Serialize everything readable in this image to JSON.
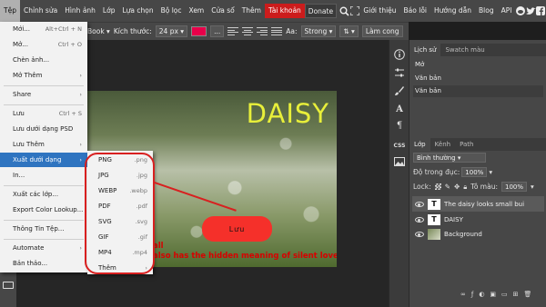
{
  "menubar": {
    "items": [
      "Tệp",
      "Chỉnh sửa",
      "Hình ảnh",
      "Lớp",
      "Lựa chọn",
      "Bộ lọc",
      "Xem",
      "Cửa sổ",
      "Thêm"
    ],
    "account": "Tài khoản",
    "donate": "Donate",
    "right_items": [
      "Giới thiệu",
      "Báo lỗi",
      "Hướng dẫn",
      "Blog",
      "API"
    ]
  },
  "optbar": {
    "font": "Book",
    "size_label": "Kích thước:",
    "size_value": "24 px",
    "color": "#e8004a",
    "more": "...",
    "aa_label": "Aa:",
    "aa_value": "Strong",
    "commit": "Làm cong"
  },
  "filemenu": {
    "items": [
      {
        "label": "Mới...",
        "shortcut": "Alt+Ctrl + N"
      },
      {
        "label": "Mở...",
        "shortcut": "Ctrl + O"
      },
      {
        "label": "Chèn ảnh...",
        "shortcut": ""
      },
      {
        "label": "Mở Thêm",
        "shortcut": "›"
      },
      {
        "label": "Share",
        "shortcut": "›"
      },
      {
        "label": "Lưu",
        "shortcut": "Ctrl + S"
      },
      {
        "label": "Lưu dưới dạng PSD",
        "shortcut": ""
      },
      {
        "label": "Lưu Thêm",
        "shortcut": "›"
      },
      {
        "label": "Xuất dưới dạng",
        "shortcut": "›"
      },
      {
        "label": "In...",
        "shortcut": ""
      },
      {
        "label": "Xuất các lớp...",
        "shortcut": ""
      },
      {
        "label": "Export Color Lookup...",
        "shortcut": ""
      },
      {
        "label": "Thông Tin Tệp...",
        "shortcut": ""
      },
      {
        "label": "Automate",
        "shortcut": "›"
      },
      {
        "label": "Bản thảo...",
        "shortcut": ""
      }
    ]
  },
  "submenu": {
    "items": [
      {
        "label": "PNG",
        "ext": ".png"
      },
      {
        "label": "JPG",
        "ext": ".jpg"
      },
      {
        "label": "WEBP",
        "ext": ".webp"
      },
      {
        "label": "PDF",
        "ext": ".pdf"
      },
      {
        "label": "SVG",
        "ext": ".svg"
      },
      {
        "label": "GIF",
        "ext": ".gif"
      },
      {
        "label": "MP4",
        "ext": ".mp4"
      },
      {
        "label": "Thêm",
        "ext": "›"
      }
    ]
  },
  "canvas": {
    "title": "DAISY",
    "caption_line1": "all",
    "caption_line2": "also has the hidden meaning of silent love.",
    "save_button": "Lưu"
  },
  "history": {
    "tabs": [
      "Lịch sử",
      "Swatch màu"
    ],
    "items": [
      "Mở",
      "Văn bản",
      "Văn bản"
    ]
  },
  "layers": {
    "tabs": [
      "Lớp",
      "Kênh",
      "Path"
    ],
    "blend": "Bình thường",
    "opacity_label": "Độ trong đục:",
    "opacity_value": "100%",
    "lock_label": "Lock:",
    "fill_label": "Tô màu:",
    "fill_value": "100%",
    "items": [
      {
        "name": "The daisy looks small bui",
        "thumb": "T"
      },
      {
        "name": "DAISY",
        "thumb": "T"
      },
      {
        "name": "Background",
        "thumb": ""
      }
    ]
  },
  "miniside": {
    "labels": [
      "CSS"
    ]
  }
}
